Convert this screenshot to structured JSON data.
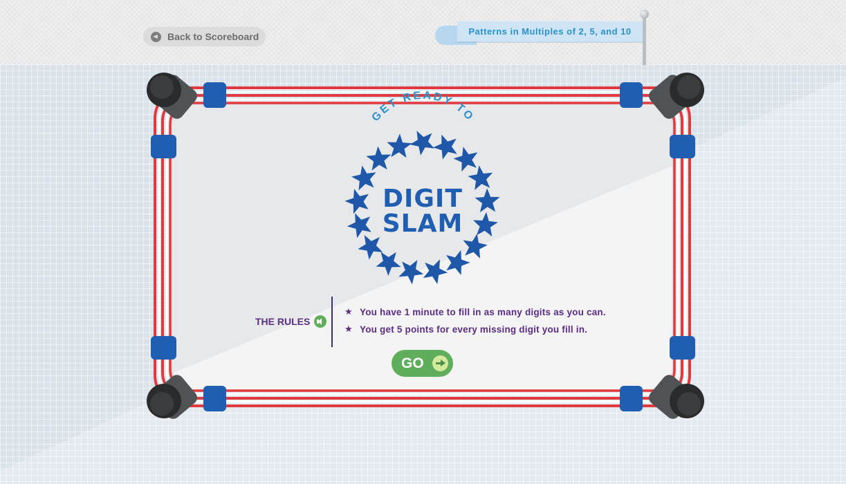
{
  "nav": {
    "back_label": "Back to Scoreboard",
    "back_icon": "arrow-left-icon"
  },
  "lesson": {
    "title": "Patterns in Multiples of 2, 5, and 10"
  },
  "game": {
    "tagline": "GET READY TO",
    "logo_line1": "DIGIT",
    "logo_line2": "SLAM",
    "rules_title": "THE RULES",
    "rules": [
      "You have 1 minute to fill in as many digits as you can.",
      "You get 5 points for every missing digit you fill in."
    ],
    "go_label": "GO"
  },
  "colors": {
    "rope_red": "#e03a3e",
    "post_pad_blue": "#1f5eb1",
    "star_blue": "#1f58a8",
    "rules_purple": "#5a2d82",
    "go_green": "#5fae5b",
    "tagline_blue": "#2a91c9"
  }
}
